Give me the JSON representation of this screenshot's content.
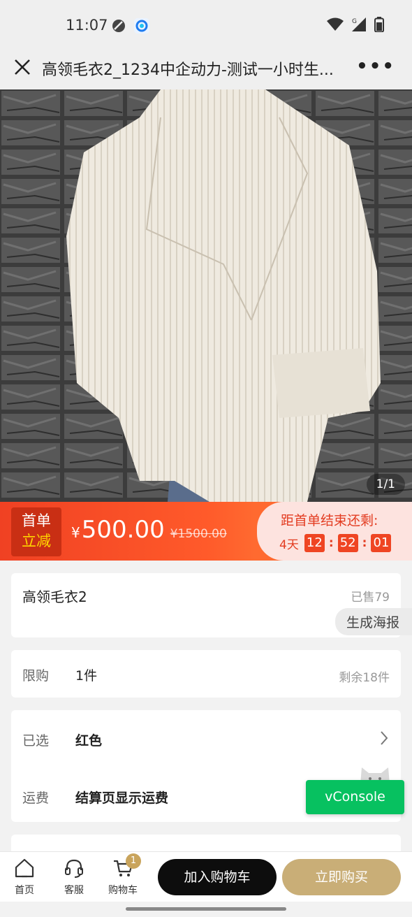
{
  "status_bar": {
    "time": "11:07",
    "icons": [
      "do-not-disturb-icon",
      "browser-app-icon",
      "wifi-icon",
      "cellular-signal-icon",
      "battery-icon"
    ],
    "network_label": "G"
  },
  "nav": {
    "title": "高领毛衣2_1234中企动力-测试一小时生...",
    "close_icon": "close-icon",
    "more_label": "•••"
  },
  "product_image": {
    "counter": "1/1"
  },
  "promo": {
    "tag_line1": "首单",
    "tag_line2": "立减",
    "currency": "¥",
    "price": "500.00",
    "original_price": "¥1500.00",
    "countdown_label": "距首单结束还剩:",
    "days": "4天",
    "hours": "12",
    "minutes": "52",
    "seconds": "01",
    "separator": ":"
  },
  "product": {
    "title": "高领毛衣2",
    "sold": "已售79",
    "poster_button": "生成海报"
  },
  "limit": {
    "label": "限购",
    "value": "1件",
    "remaining": "剩余18件"
  },
  "options": {
    "selected_label": "已选",
    "selected_value": "红色",
    "shipping_label": "运费",
    "shipping_value": "结算页显示运费"
  },
  "vconsole": {
    "label": "vConsole"
  },
  "bottom_bar": {
    "home_label": "首页",
    "service_label": "客服",
    "cart_label": "购物车",
    "cart_badge": "1",
    "add_to_cart": "加入购物车",
    "buy_now": "立即购买"
  },
  "colors": {
    "promo_red": "#f04123",
    "countdown_bg": "#fde3df",
    "gold": "#c9ae77",
    "vconsole_green": "#07c160"
  }
}
